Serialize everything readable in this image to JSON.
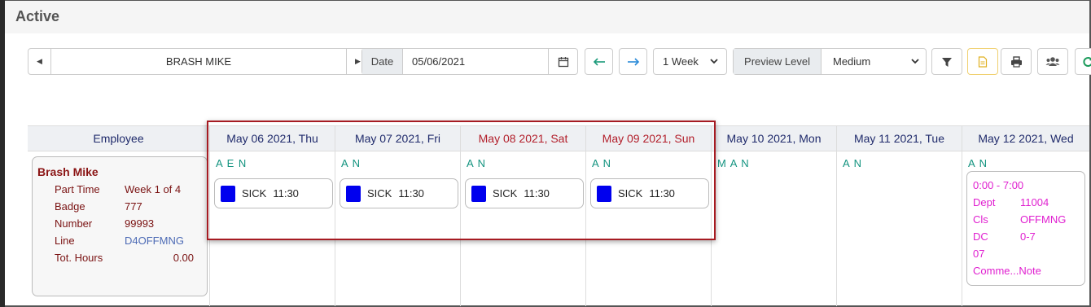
{
  "page": {
    "title": "Active"
  },
  "toolbar": {
    "employee_name": "BRASH MIKE",
    "date_label": "Date",
    "date_value": "05/06/2021",
    "range_value": "1 Week",
    "preview_label": "Preview Level",
    "preview_value": "Medium"
  },
  "colors": {
    "header_text": "#1f2a6b",
    "weekend_text": "#b21e2a",
    "codes_text": "#12937f",
    "shift_swatch": "#0000ee",
    "highlight_border": "#a61b22",
    "detail_text": "#e020d0"
  },
  "grid": {
    "employee_header": "Employee",
    "days": [
      {
        "label": "May 06 2021, Thu",
        "codes": "A E N",
        "shift": {
          "type": "SICK",
          "time": "11:30"
        }
      },
      {
        "label": "May 07 2021, Fri",
        "codes": "A N",
        "shift": {
          "type": "SICK",
          "time": "11:30"
        }
      },
      {
        "label": "May 08 2021, Sat",
        "codes": "A N",
        "shift": {
          "type": "SICK",
          "time": "11:30"
        }
      },
      {
        "label": "May 09 2021, Sun",
        "codes": "A N",
        "shift": {
          "type": "SICK",
          "time": "11:30"
        }
      },
      {
        "label": "May 10 2021, Mon",
        "codes": "M A N"
      },
      {
        "label": "May 11 2021, Tue",
        "codes": "A N"
      },
      {
        "label": "May 12 2021, Wed",
        "codes": "A N",
        "detail": {
          "time": "0:00 - 7:00",
          "dept_label": "Dept",
          "dept_value": "11004",
          "cls_label": "Cls",
          "cls_value": "OFFMNG",
          "dc_label": "DC",
          "dc_value": "0-7",
          "dc_extra": "07",
          "comment": "Comme...Note"
        }
      }
    ]
  },
  "employee": {
    "name": "Brash Mike",
    "part_time_label": "Part Time",
    "part_time_value": "Week 1 of 4",
    "badge_label": "Badge",
    "badge_value": "777",
    "number_label": "Number",
    "number_value": "99993",
    "line_label": "Line",
    "line_value": "D4OFFMNG",
    "hours_label": "Tot. Hours",
    "hours_value": "0.00"
  }
}
